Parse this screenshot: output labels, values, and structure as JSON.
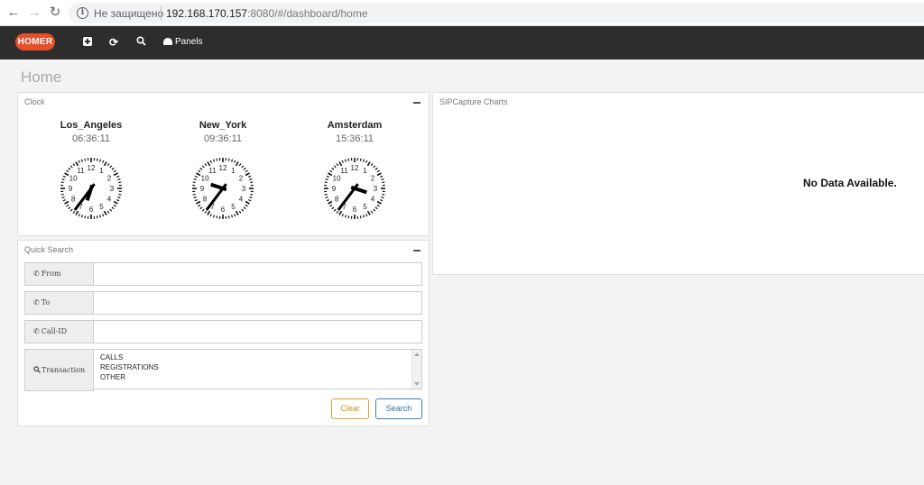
{
  "browser": {
    "security_text": "Не защищено",
    "url_host": "192.168.170.157",
    "url_rest": ":8080/#/dashboard/home",
    "back_icon": "arrow-left-icon",
    "forward_icon": "arrow-right-icon",
    "reload_icon": "reload-icon",
    "info_icon": "info-icon"
  },
  "navbar": {
    "logo_text": "HOMER",
    "panels_label": "Panels",
    "icons": [
      "plus-square-icon",
      "refresh-icon",
      "search-icon",
      "dashboard-icon"
    ],
    "logo_color": "#e4502a",
    "bg_color": "#2d2d2d"
  },
  "page": {
    "title": "Home"
  },
  "clock_panel": {
    "title": "Clock",
    "clocks": [
      {
        "city": "Los_Angeles",
        "time": "06:36:11"
      },
      {
        "city": "New_York",
        "time": "09:36:11"
      },
      {
        "city": "Amsterdam",
        "time": "15:36:11"
      }
    ]
  },
  "chart_panel": {
    "title": "SIPCapture Charts",
    "empty_text": "No Data Available."
  },
  "quick_search": {
    "title": "Quick Search",
    "fields": [
      {
        "label": "From",
        "value": ""
      },
      {
        "label": "To",
        "value": ""
      },
      {
        "label": "Call-ID",
        "value": ""
      }
    ],
    "transaction_label": "Transaction",
    "transaction_options": [
      "CALLS",
      "REGISTRATIONS",
      "OTHER"
    ],
    "clear_label": "Clear",
    "search_label": "Search",
    "clear_color": "#d98e10",
    "search_color": "#2f6ea3"
  }
}
